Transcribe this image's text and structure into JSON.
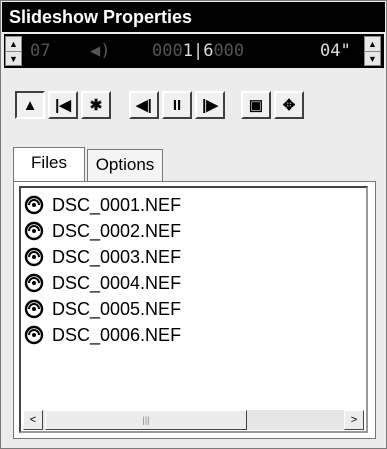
{
  "window": {
    "title": "Slideshow Properties"
  },
  "lcd": {
    "left_value": "07",
    "sound_icon": "speaker-icon",
    "counter": "0001|6000",
    "counter_bright": "1|6",
    "counter_dim_left": "000",
    "counter_dim_right": "000",
    "right_value": "04\""
  },
  "toolbar": {
    "buttons": [
      {
        "name": "stop-button",
        "icon": "stop-icon",
        "glyph": "▲"
      },
      {
        "name": "first-button",
        "icon": "first-icon",
        "glyph": "|◀"
      },
      {
        "name": "settings-button",
        "icon": "gear-icon",
        "glyph": "✱"
      },
      {
        "name": "previous-button",
        "icon": "previous-icon",
        "glyph": "◀|"
      },
      {
        "name": "pause-button",
        "icon": "pause-icon",
        "glyph": "II"
      },
      {
        "name": "next-button",
        "icon": "next-icon",
        "glyph": "|▶"
      },
      {
        "name": "slide-button",
        "icon": "slide-icon",
        "glyph": "▣"
      },
      {
        "name": "fullscreen-button",
        "icon": "fullscreen-icon",
        "glyph": "❐"
      }
    ]
  },
  "tabs": [
    {
      "label": "Files"
    },
    {
      "label": "Options"
    }
  ],
  "files": [
    "DSC_0001.NEF",
    "DSC_0002.NEF",
    "DSC_0003.NEF",
    "DSC_0004.NEF",
    "DSC_0005.NEF",
    "DSC_0006.NEF"
  ],
  "scrollbar": {
    "left": "<",
    "right": ">",
    "grip": "|||"
  }
}
